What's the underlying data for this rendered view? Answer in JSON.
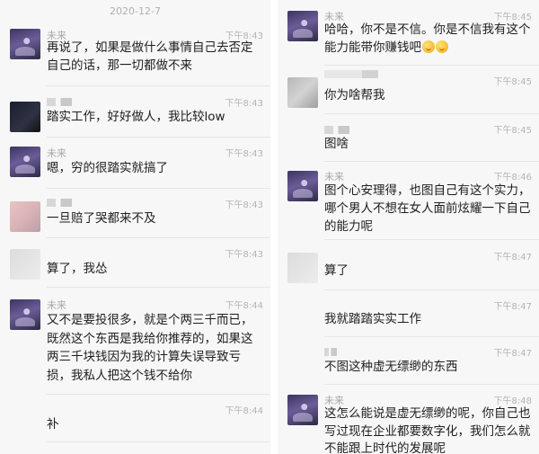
{
  "left_column": {
    "date_header": "2020-12-7",
    "messages": [
      {
        "name": "未来",
        "time": "下午8:43",
        "text": "再说了，如果是做什么事情自己去否定自己的话，那一切都做不来"
      },
      {
        "name": "",
        "time": "下午8:43",
        "text": "踏实工作，好好做人，我比较low"
      },
      {
        "name": "未来",
        "time": "下午8:43",
        "text": "嗯，穷的很踏实就搞了"
      },
      {
        "name": "",
        "time": "下午8:43",
        "text": "一旦赔了哭都来不及"
      },
      {
        "name": "",
        "time": "下午8:43",
        "text": "算了，我怂"
      },
      {
        "name": "未来",
        "time": "下午8:44",
        "text": "又不是要投很多，就是个两三千而已，既然这个东西是我给你推荐的，如果这两三千块钱因为我的计算失误导致亏损，我私人把这个钱不给你"
      },
      {
        "name": "",
        "time": "下午8:44",
        "text": "补"
      }
    ]
  },
  "right_column": {
    "messages": [
      {
        "name": "未来",
        "time": "下午8:45",
        "text": "哈哈，你不是不信。你是不信我有这个能力能带你赚钱吧",
        "emoji": [
          "grin-emoji",
          "grin-emoji"
        ]
      },
      {
        "name": "",
        "time": "下午8:45",
        "text": "你为啥帮我"
      },
      {
        "name": "",
        "time": "下午8:45",
        "text": "图啥"
      },
      {
        "name": "未来",
        "time": "下午8:46",
        "text": "图个心安理得，也图自己有这个实力，哪个男人不想在女人面前炫耀一下自己的能力呢"
      },
      {
        "name": "",
        "time": "下午8:47",
        "text": "算了"
      },
      {
        "name": "",
        "time": "下午8:47",
        "text": "我就踏踏实实工作"
      },
      {
        "name": "",
        "time": "下午8:47",
        "text": "不图这种虚无缥缈的东西"
      },
      {
        "name": "未来",
        "time": "下午8:48",
        "text": "这怎么能说是虚无缥缈的呢，你自己也写过现在企业都要数字化，我们怎么就不能跟上时代的发展呢"
      }
    ]
  }
}
